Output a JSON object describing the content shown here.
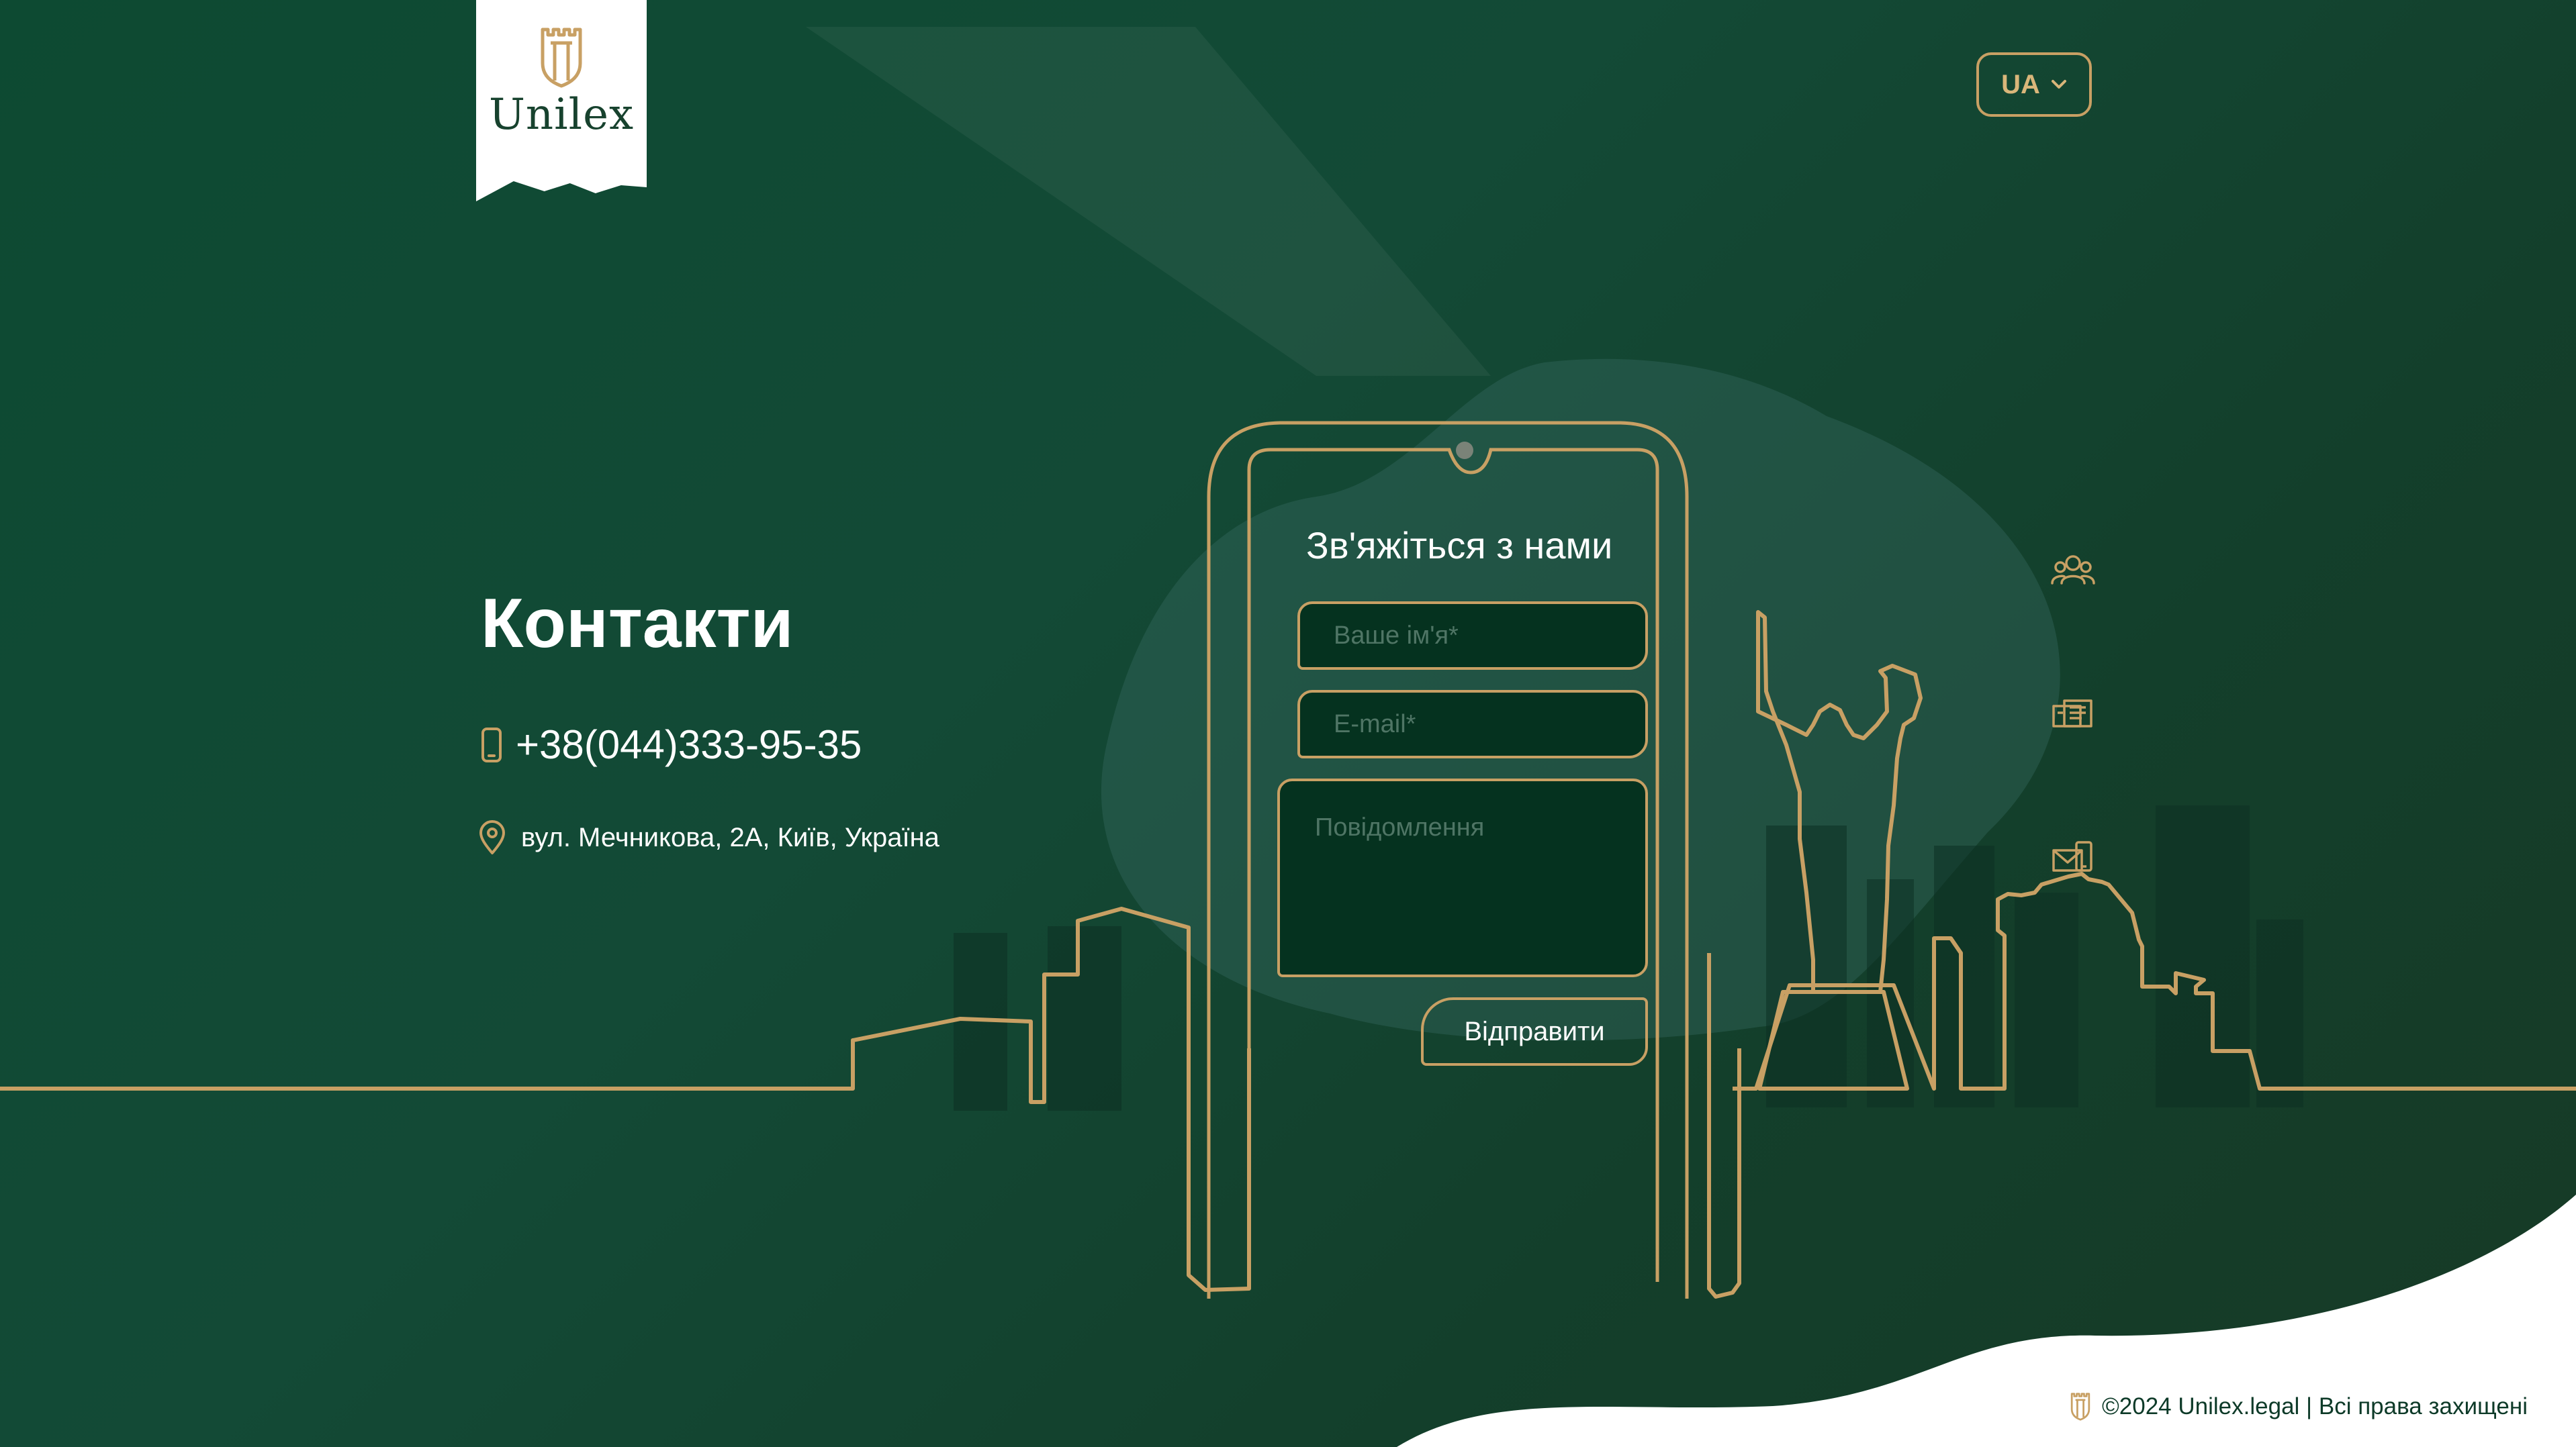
{
  "brand": {
    "name": "Unilex"
  },
  "language": {
    "current": "UA"
  },
  "contacts": {
    "title": "Контакти",
    "phone": "+38(044)333-95-35",
    "address": "вул. Мечникова, 2А, Київ, Україна"
  },
  "form": {
    "title": "Зв'яжіться з нами",
    "name_placeholder": "Ваше ім'я*",
    "email_placeholder": "E-mail*",
    "message_placeholder": "Повідомлення",
    "submit_label": "Відправити"
  },
  "side_icons": [
    "team-icon",
    "documents-icon",
    "mail-icon"
  ],
  "footer": {
    "copyright": "©2024 Unilex.legal | Всі права захищені"
  },
  "colors": {
    "accent": "#c8a064",
    "background": "#134a36",
    "field": "#05321f",
    "white": "#ffffff"
  }
}
